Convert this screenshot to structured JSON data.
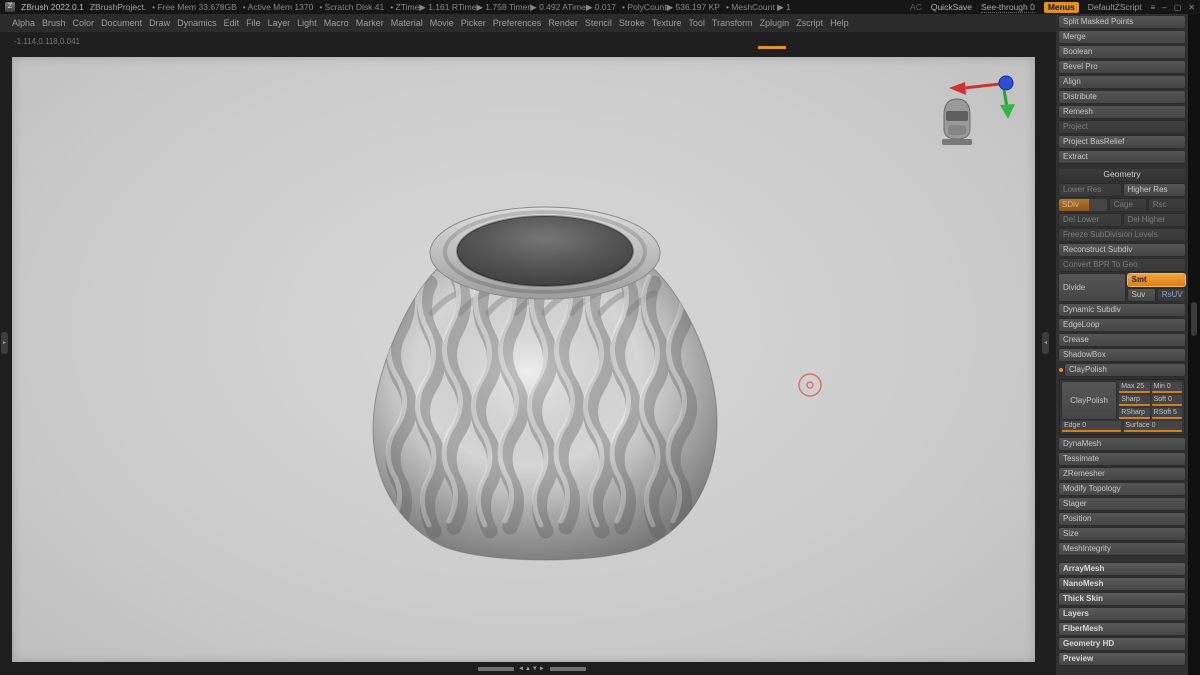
{
  "titlebar": {
    "logo": "Z",
    "app_title": "ZBrush 2022.0.1",
    "project": "ZBrushProject.",
    "stats": [
      "• Free Mem 33.678GB",
      "• Active Mem 1370",
      "• Scratch Disk 41",
      "• ZTime▶ 1.161 RTime▶ 1.758 Timer▶ 0.492 ATime▶ 0.017",
      "• PolyCount▶ 536.197 KP",
      "• MeshCount ▶ 1"
    ],
    "ac": "AC",
    "quicksave": "QuickSave",
    "see_through": "See-through 0",
    "menus": "Menus",
    "default_zscript": "DefaultZScript",
    "window": {
      "menu": "≡",
      "minimize": "–",
      "maximize": "▢",
      "close": "✕"
    }
  },
  "menubar": {
    "items": [
      "Alpha",
      "Brush",
      "Color",
      "Document",
      "Draw",
      "Dynamics",
      "Edit",
      "File",
      "Layer",
      "Light",
      "Macro",
      "Marker",
      "Material",
      "Movie",
      "Picker",
      "Preferences",
      "Render",
      "Stencil",
      "Stroke",
      "Texture",
      "Tool",
      "Transform",
      "Zplugin",
      "Zscript",
      "Help"
    ]
  },
  "statusline": {
    "coords": "-1.114,0.118,0.041"
  },
  "canvas_widgets": {
    "nav_glyphs": "◄▲▼►",
    "tray_left_arrow": "▸",
    "tray_mid_arrow": "◂"
  },
  "tool_panel": {
    "top_buttons": [
      "Split Masked Points",
      "Merge",
      "Boolean",
      "Bevel Pro",
      "Align",
      "Distribute",
      "Remesh",
      "Project",
      "Project BasRelief",
      "Extract"
    ],
    "geometry": {
      "header": "Geometry",
      "lower_res": "Lower Res",
      "higher_res": "Higher Res",
      "sdiv": "SDiv",
      "cage": "Cage",
      "rsc": "Rsc",
      "del_lower": "Del Lower",
      "del_higher": "Del Higher",
      "freeze": "Freeze SubDivision Levels",
      "reconstruct": "Reconstruct Subdiv",
      "convert_bpr": "Convert BPR To Geo",
      "divide": "Divide",
      "smt": "Smt",
      "suv": "Suv",
      "rsuv": "RsUV",
      "sections": [
        "Dynamic Subdiv",
        "EdgeLoop",
        "Crease",
        "ShadowBox"
      ],
      "claypolish": {
        "label": "ClayPolish",
        "button": "ClayPolish",
        "max": "Max 25",
        "min": "Min 0",
        "sharp": "Sharp",
        "soft": "Soft 0",
        "rsharp": "RSharp",
        "rsoft": "RSoft 5",
        "edge": "Edge 0",
        "surface": "Surface 0"
      },
      "sections2": [
        "DynaMesh",
        "Tessimate",
        "ZRemesher",
        "Modify Topology",
        "Stager",
        "Position",
        "Size",
        "MeshIntegrity"
      ]
    },
    "bottom_sections": [
      "ArrayMesh",
      "NanoMesh",
      "Thick Skin",
      "Layers",
      "FiberMesh",
      "Geometry HD",
      "Preview"
    ]
  },
  "colors": {
    "accent_orange": "#e0921e",
    "active_button_orange": "#e08a1f",
    "rsuv_blue": "#8fa3c8",
    "cursor_red": "#d97272",
    "canvas_gray": "#cdcdcd"
  }
}
